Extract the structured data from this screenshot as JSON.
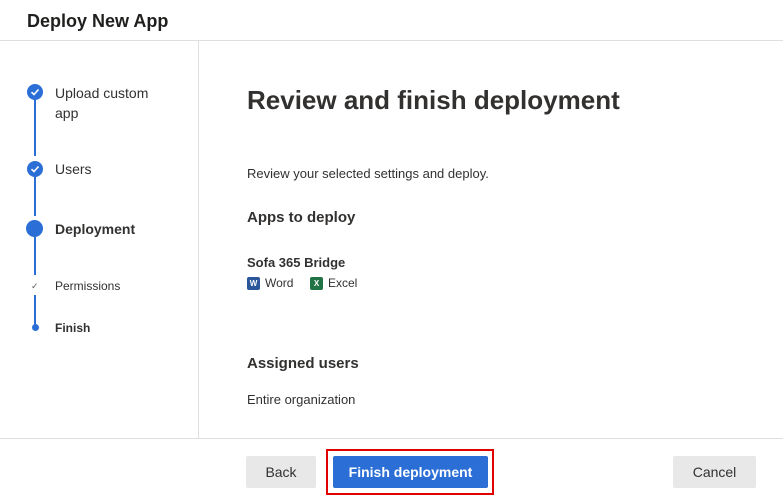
{
  "header": {
    "title": "Deploy New App"
  },
  "steps": [
    {
      "label_line1": "Upload custom",
      "label_line2": "app",
      "state": "complete"
    },
    {
      "label": "Users",
      "state": "complete"
    },
    {
      "label": "Deployment",
      "state": "current"
    },
    {
      "label": "Permissions",
      "state": "complete-substep"
    },
    {
      "label": "Finish",
      "state": "current-substep"
    }
  ],
  "main": {
    "title": "Review and finish deployment",
    "subtitle": "Review your selected settings and deploy.",
    "apps_heading": "Apps to deploy",
    "app_name": "Sofa 365 Bridge",
    "hosts": [
      {
        "label": "Word",
        "icon": "word-icon",
        "letter": "W",
        "color": "#2b579a"
      },
      {
        "label": "Excel",
        "icon": "excel-icon",
        "letter": "X",
        "color": "#217346"
      }
    ],
    "users_heading": "Assigned users",
    "users_value": "Entire organization"
  },
  "footer": {
    "back_label": "Back",
    "finish_label": "Finish deployment",
    "cancel_label": "Cancel"
  },
  "colors": {
    "accent": "#2b6fd6",
    "highlight": "#e00000"
  }
}
